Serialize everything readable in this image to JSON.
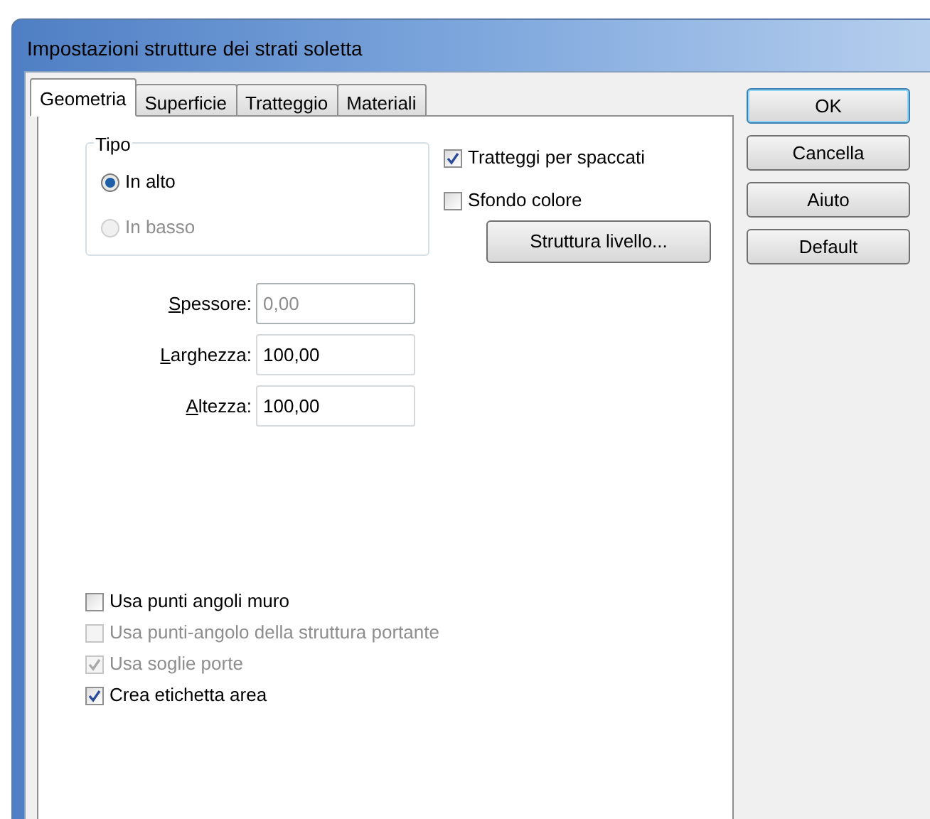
{
  "window": {
    "title": "Impostazioni strutture dei strati soletta"
  },
  "tabs": [
    {
      "label": "Geometria",
      "selected": true
    },
    {
      "label": "Superficie",
      "selected": false
    },
    {
      "label": "Tratteggio",
      "selected": false
    },
    {
      "label": "Materiali",
      "selected": false
    }
  ],
  "tipo": {
    "label": "Tipo",
    "options": [
      {
        "label": "In alto",
        "selected": true,
        "disabled": false
      },
      {
        "label": "In basso",
        "selected": false,
        "disabled": true
      }
    ]
  },
  "options_right": [
    {
      "label": "Tratteggi per spaccati",
      "checked": true,
      "disabled": false
    },
    {
      "label": "Sfondo colore",
      "checked": false,
      "disabled": false
    }
  ],
  "struttura_button": "Struttura livello...",
  "fields": [
    {
      "label": "Spessore:",
      "value": "0,00",
      "disabled": true
    },
    {
      "label": "Larghezza:",
      "value": "100,00",
      "disabled": false
    },
    {
      "label": "Altezza:",
      "value": "100,00",
      "disabled": false
    }
  ],
  "options_bottom": [
    {
      "label": "Usa punti angoli muro",
      "checked": false,
      "disabled": false
    },
    {
      "label": "Usa punti-angolo della struttura portante",
      "checked": false,
      "disabled": true
    },
    {
      "label": "Usa soglie porte",
      "checked": true,
      "disabled": true
    },
    {
      "label": "Crea etichetta area",
      "checked": true,
      "disabled": false
    }
  ],
  "buttons": [
    {
      "label": "OK",
      "default": true
    },
    {
      "label": "Cancella",
      "default": false
    },
    {
      "label": "Aiuto",
      "default": false
    },
    {
      "label": "Default",
      "default": false
    }
  ]
}
